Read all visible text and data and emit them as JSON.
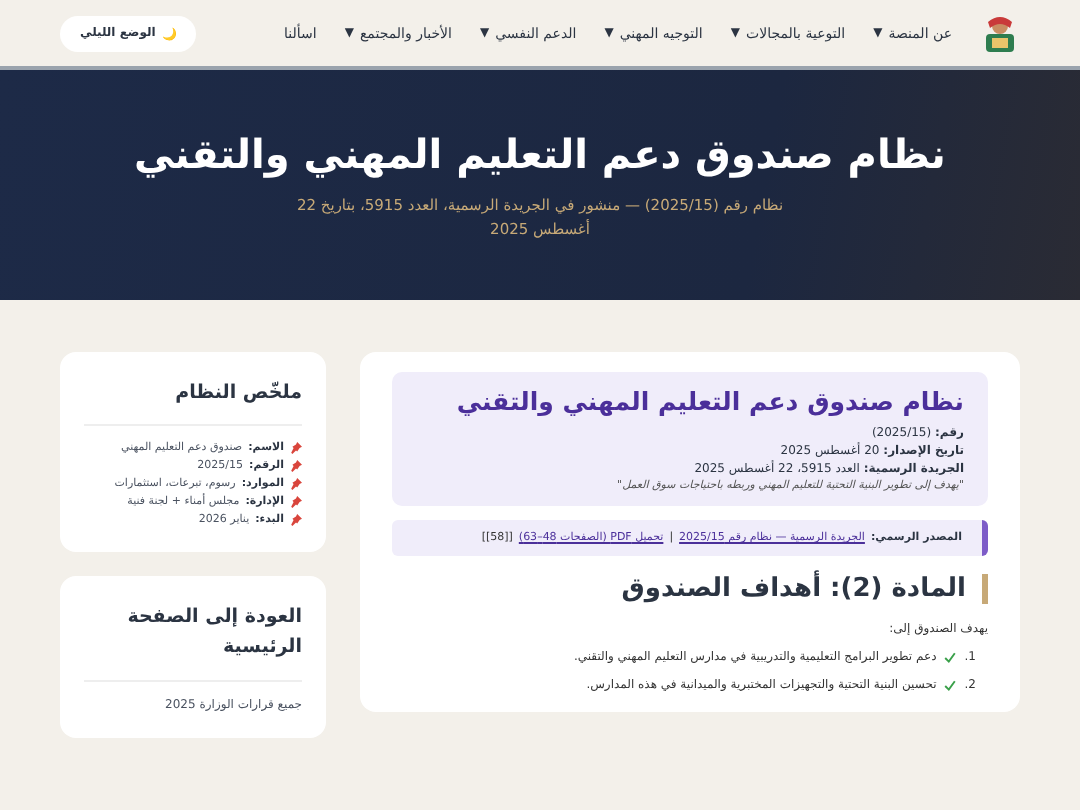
{
  "nav": {
    "items": [
      {
        "label": "عن المنصة",
        "caret": "▼"
      },
      {
        "label": "التوعية بالمجالات",
        "caret": "▼"
      },
      {
        "label": "التوجيه المهني",
        "caret": "▼"
      },
      {
        "label": "الدعم النفسي",
        "caret": "▼"
      },
      {
        "label": "الأخبار والمجتمع",
        "caret": "▼"
      },
      {
        "label": "اسألنا"
      }
    ],
    "mode_button": {
      "icon": "🌙",
      "label": "الوضع الليلي"
    }
  },
  "hero": {
    "title": "نظام صندوق دعم التعليم المهني والتقني",
    "subtitle": "نظام رقم (2025/15) — منشور في الجريدة الرسمية، العدد 5915، بتاريخ 22 أغسطس 2025"
  },
  "summary": {
    "title": "ملخّص النظام",
    "items": [
      {
        "label": "الاسم:",
        "value": "صندوق دعم التعليم المهني"
      },
      {
        "label": "الرقم:",
        "value": "2025/15"
      },
      {
        "label": "الموارد:",
        "value": "رسوم، تبرعات، استثمارات"
      },
      {
        "label": "الإدارة:",
        "value": "مجلس أمناء + لجنة فنية"
      },
      {
        "label": "البدء:",
        "value": "يناير 2026"
      }
    ]
  },
  "back": {
    "title": "العودة إلى الصفحة الرئيسية",
    "link": "جميع قرارات الوزارة 2025"
  },
  "doc": {
    "title": "نظام صندوق دعم التعليم المهني والتقني",
    "meta": [
      {
        "label": "رقم:",
        "value": "(2025/15)"
      },
      {
        "label": "تاريخ الإصدار:",
        "value": "20 أغسطس 2025"
      },
      {
        "label": "الجريدة الرسمية:",
        "value": "العدد 5915، 22 أغسطس 2025"
      }
    ],
    "quote": "\"يهدف إلى تطوير البنية التحتية للتعليم المهني وربطه باحتياجات سوق العمل\""
  },
  "source": {
    "label": "المصدر الرسمي:",
    "link1": "الجريدة الرسمية — نظام رقم 2025/15",
    "separator": "|",
    "link2": "تحميل PDF (الصفحات 48–63)",
    "ref": "[[58]]"
  },
  "article": {
    "title": "المادة (2): أهداف الصندوق",
    "intro": "يهدف الصندوق إلى:",
    "items": [
      {
        "number": "1.",
        "text": "دعم تطوير البرامج التعليمية والتدريبية في مدارس التعليم المهني والتقني."
      },
      {
        "number": "2.",
        "text": "تحسين البنية التحتية والتجهيزات المختبرية والميدانية في هذه المدارس."
      }
    ]
  }
}
